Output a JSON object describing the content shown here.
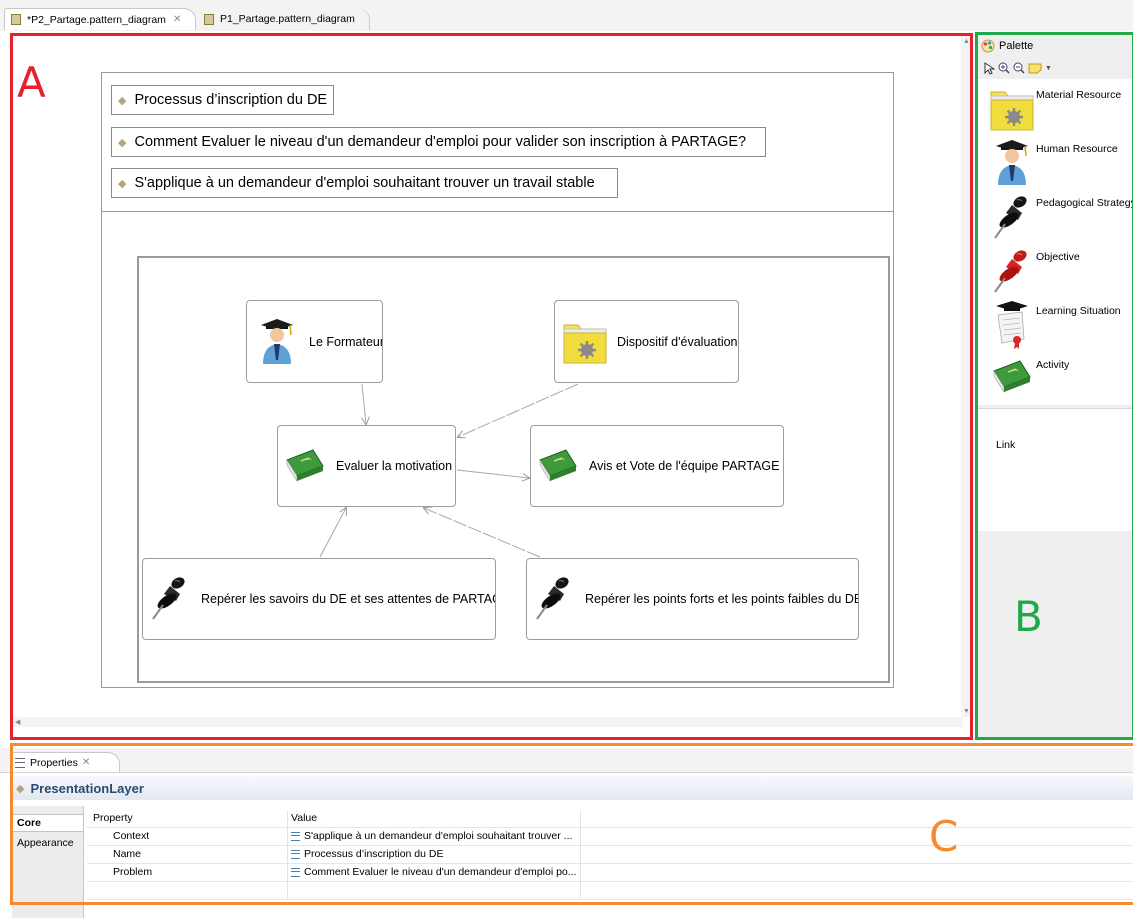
{
  "editor_tabs": [
    {
      "label": "*P2_Partage.pattern_diagram",
      "close": "✕"
    },
    {
      "label": "P1_Partage.pattern_diagram"
    }
  ],
  "region_labels": {
    "a": "A",
    "b": "B",
    "c": "C"
  },
  "pattern": {
    "process": "Processus d’inscription du DE",
    "problem": "Comment Evaluer le niveau d'un demandeur d'emploi pour valider son inscription à PARTAGE?",
    "context": "S'applique à un demandeur d'emploi souhaitant trouver un travail stable"
  },
  "nodes": {
    "formateur": {
      "label": "Le Formateur",
      "icon": "human-resource-icon"
    },
    "dispositif": {
      "label": "Dispositif d'évaluation",
      "icon": "material-resource-icon"
    },
    "evaluer": {
      "label": "Evaluer la motivation d",
      "icon": "activity-icon"
    },
    "avis": {
      "label": "Avis et Vote de l'équipe PARTAGE",
      "icon": "activity-icon"
    },
    "reperer_savoirs": {
      "label": "Repérer les savoirs du DE et ses attentes de PARTAGE",
      "icon": "pedagogical-strategy-icon"
    },
    "reperer_points": {
      "label": "Repérer les points forts et les points faibles du DE",
      "icon": "pedagogical-strategy-icon"
    }
  },
  "palette": {
    "title": "Palette",
    "items": [
      {
        "label": "Material Resource",
        "icon": "material-resource-icon"
      },
      {
        "label": "Human Resource",
        "icon": "human-resource-icon"
      },
      {
        "label": "Pedagogical Strategy",
        "icon": "pedagogical-strategy-icon"
      },
      {
        "label": "Objective",
        "icon": "objective-icon"
      },
      {
        "label": "Learning Situation",
        "icon": "learning-situation-icon"
      },
      {
        "label": "Activity",
        "icon": "activity-icon"
      }
    ],
    "link_label": "Link"
  },
  "properties": {
    "tab_label": "Properties",
    "tab_close": "✕",
    "title": "PresentationLayer",
    "side_tabs": [
      "Core",
      "Appearance"
    ],
    "columns": [
      "Property",
      "Value"
    ],
    "rows": [
      {
        "property": "Context",
        "value": "S'applique à un demandeur d'emploi souhaitant trouver ..."
      },
      {
        "property": "Name",
        "value": "Processus d’inscription du DE"
      },
      {
        "property": "Problem",
        "value": "Comment Evaluer le niveau d'un demandeur d'emploi po..."
      }
    ]
  },
  "colors": {
    "region_a": "#e8202b",
    "region_b": "#1faa47",
    "region_c": "#f58a2e",
    "properties_title": "#2b4a74"
  }
}
